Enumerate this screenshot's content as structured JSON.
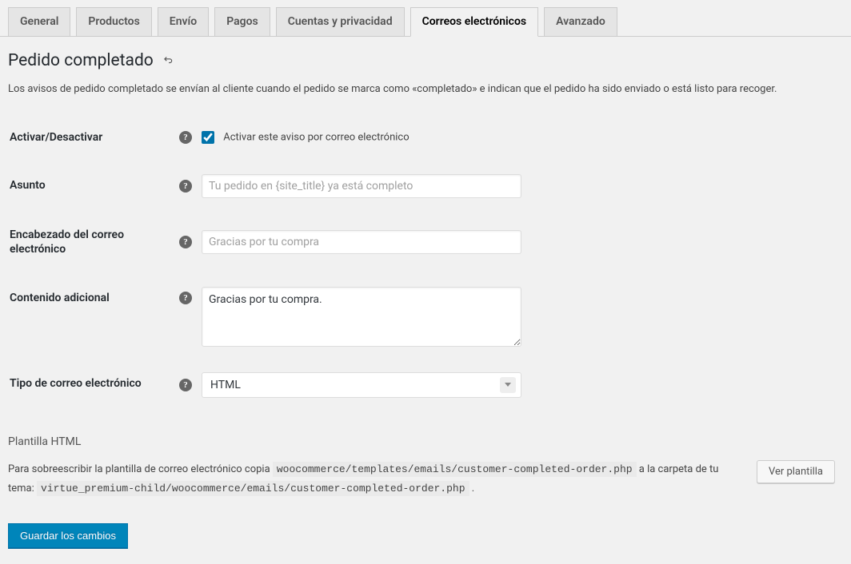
{
  "tabs": [
    {
      "label": "General",
      "active": false
    },
    {
      "label": "Productos",
      "active": false
    },
    {
      "label": "Envío",
      "active": false
    },
    {
      "label": "Pagos",
      "active": false
    },
    {
      "label": "Cuentas y privacidad",
      "active": false
    },
    {
      "label": "Correos electrónicos",
      "active": true
    },
    {
      "label": "Avanzado",
      "active": false
    }
  ],
  "page": {
    "title": "Pedido completado",
    "description": "Los avisos de pedido completado se envían al cliente cuando el pedido se marca como «completado» e indican que el pedido ha sido enviado o está listo para recoger."
  },
  "fields": {
    "enable": {
      "label": "Activar/Desactivar",
      "checkbox_label": "Activar este aviso por correo electrónico",
      "checked": true
    },
    "subject": {
      "label": "Asunto",
      "placeholder": "Tu pedido en {site_title} ya está completo",
      "value": ""
    },
    "heading": {
      "label": "Encabezado del correo electrónico",
      "placeholder": "Gracias por tu compra",
      "value": ""
    },
    "additional": {
      "label": "Contenido adicional",
      "value": "Gracias por tu compra."
    },
    "email_type": {
      "label": "Tipo de correo electrónico",
      "selected": "HTML"
    }
  },
  "template": {
    "section_title": "Plantilla HTML",
    "prefix": "Para sobreescribir la plantilla de correo electrónico copia",
    "code1": "woocommerce/templates/emails/customer-completed-order.php",
    "middle": "a la carpeta de tu tema:",
    "code2": "virtue_premium-child/woocommerce/emails/customer-completed-order.php",
    "suffix": ".",
    "view_button": "Ver plantilla"
  },
  "save_button": "Guardar los cambios",
  "help_glyph": "?"
}
